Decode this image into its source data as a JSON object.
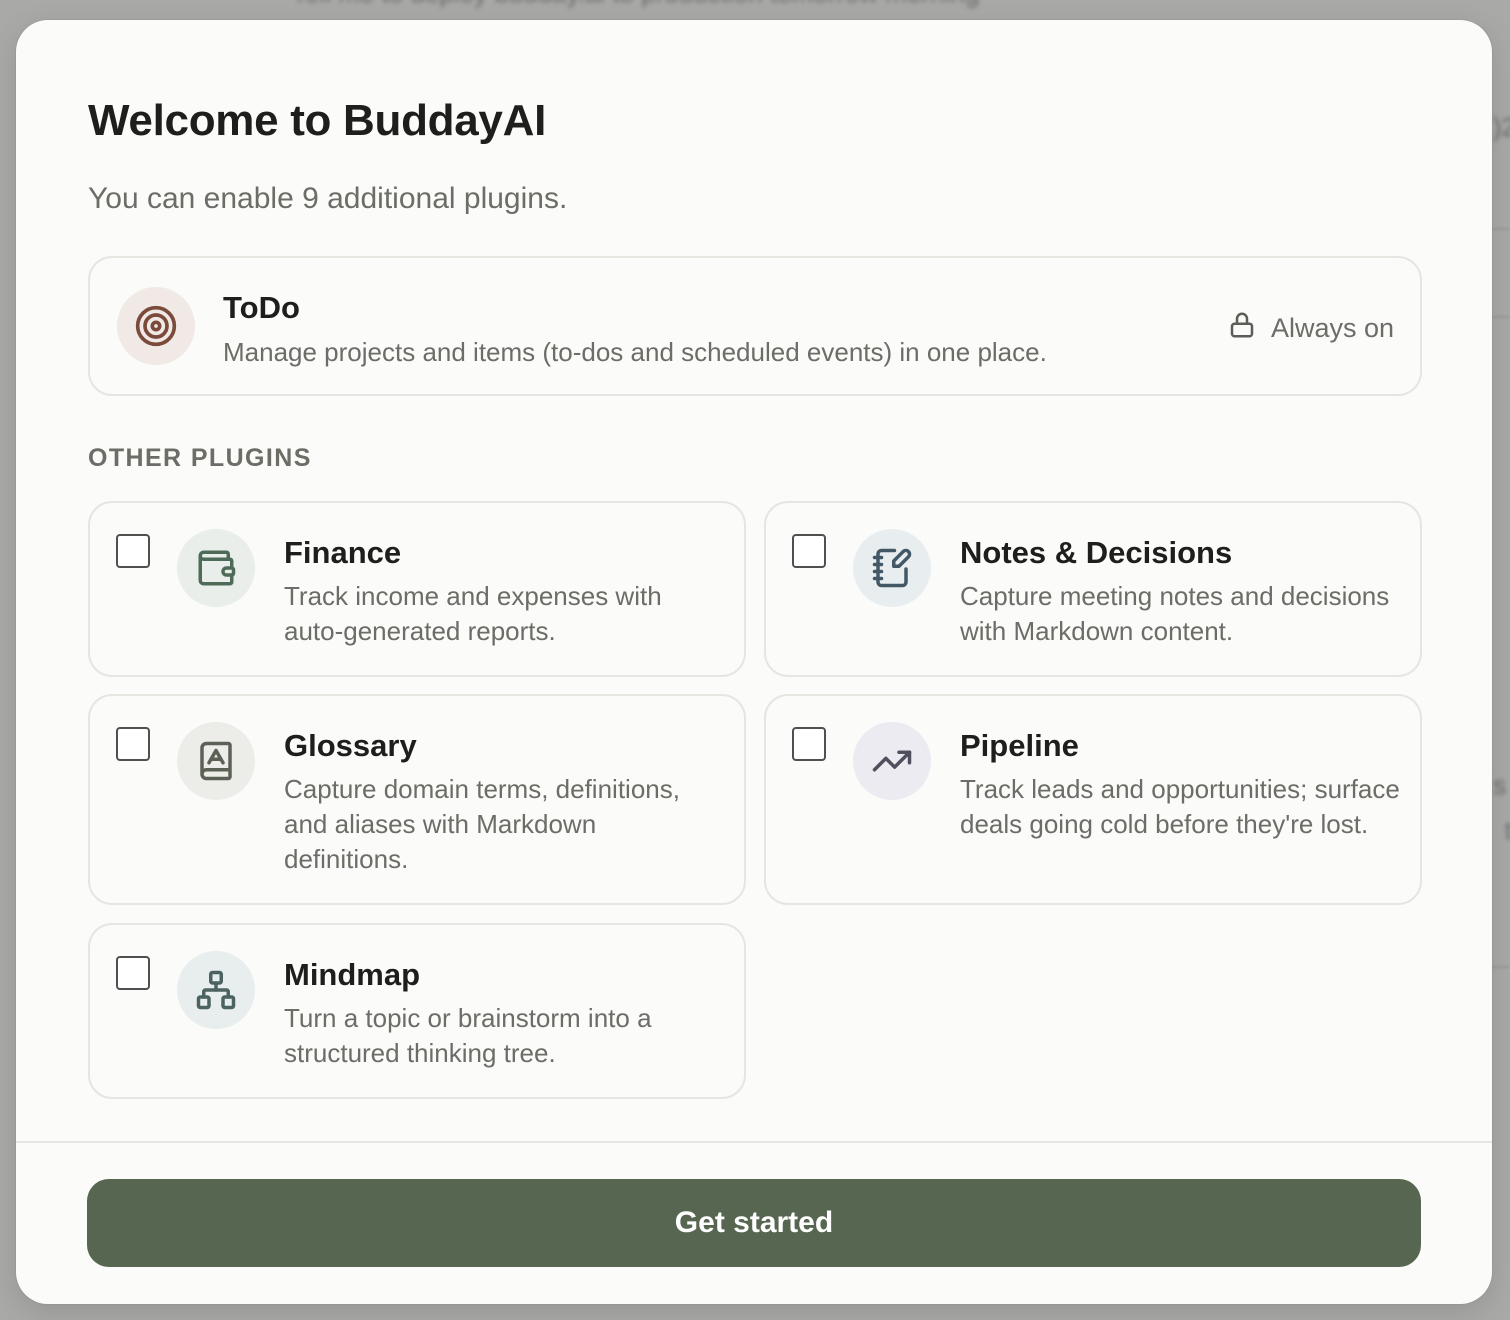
{
  "background": {
    "blurred_text": "Tell me to deploy budday.ai to production tomorrow morning"
  },
  "dialog": {
    "title": "Welcome to BuddayAI",
    "subtitle": "You can enable 9 additional plugins."
  },
  "core_plugin": {
    "name": "ToDo",
    "description": "Manage projects and items (to-dos and scheduled events) in one place.",
    "status": "Always on",
    "icon": "target-icon",
    "icon_bg": "#f1e9e6",
    "icon_color": "#7a4a3a"
  },
  "other_plugins": {
    "label": "OTHER PLUGINS",
    "items": [
      {
        "name": "Finance",
        "description": "Track income and expenses with auto-generated reports.",
        "icon": "wallet-icon",
        "icon_bg": "#e9eeea",
        "icon_color": "#4d6b57",
        "checked": false
      },
      {
        "name": "Notes & Decisions",
        "description": "Capture meeting notes and decisions with Markdown content.",
        "icon": "notebook-pen-icon",
        "icon_bg": "#e8edf0",
        "icon_color": "#435866",
        "checked": false
      },
      {
        "name": "Glossary",
        "description": "Capture domain terms, definitions, and aliases with Markdown definitions.",
        "icon": "book-a-icon",
        "icon_bg": "#ecece8",
        "icon_color": "#5c6156",
        "checked": false
      },
      {
        "name": "Pipeline",
        "description": "Track leads and opportunities; surface deals going cold before they're lost.",
        "icon": "trending-up-icon",
        "icon_bg": "#ecebf1",
        "icon_color": "#4f4f5e",
        "checked": false
      },
      {
        "name": "Mindmap",
        "description": "Turn a topic or brainstorm into a structured thinking tree.",
        "icon": "network-icon",
        "icon_bg": "#e8eeed",
        "icon_color": "#4c6362",
        "checked": false
      }
    ]
  },
  "footer": {
    "primary_button": "Get started"
  },
  "colors": {
    "primary": "#576650",
    "text": "#1e1f1c",
    "muted": "#6b6d66",
    "border": "#e6e6e1",
    "surface": "#fbfbf9",
    "overlay": "#a9a9a8"
  }
}
